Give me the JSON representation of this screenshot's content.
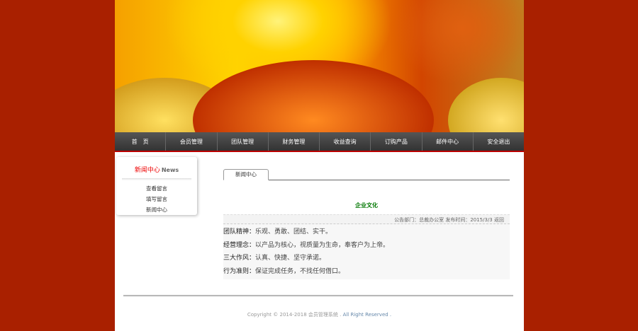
{
  "nav": [
    "首　页",
    "会员管理",
    "团队管理",
    "财务管理",
    "收益查询",
    "订购产品",
    "邮件中心",
    "安全退出"
  ],
  "sidebar": {
    "title": "新闻中心",
    "title_en": "News",
    "links": [
      "查看留言",
      "填写留言",
      "新闻中心"
    ]
  },
  "main": {
    "tab": "新闻中心",
    "article_title": "企业文化",
    "meta": "公告部门：总裁办公室  发布时间：2015/3/3",
    "back": "返回",
    "lines": [
      {
        "k": "团队精神：",
        "v": "乐观、勇敢、团结、实干。"
      },
      {
        "k": "经营理念：",
        "v": "以产品为核心，视质量为生命，奉客户为上帝。"
      },
      {
        "k": "三大作风：",
        "v": "认真、快捷、坚守承诺。"
      },
      {
        "k": "行为准则：",
        "v": "保证完成任务，不找任何借口。"
      }
    ]
  },
  "footer": {
    "copyright": "Copyright © 2014-2018 会员管理系统 .",
    "rights": "All Right Reserved ."
  }
}
